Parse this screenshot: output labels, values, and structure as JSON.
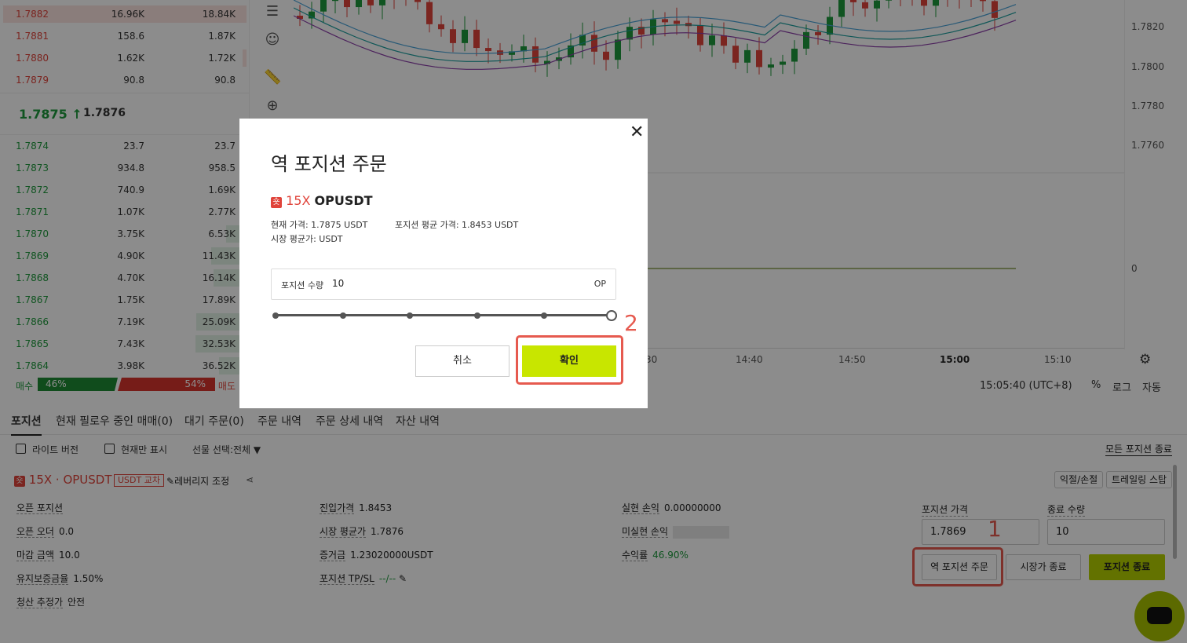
{
  "orderbook": {
    "asks": [
      {
        "price": "1.7882",
        "amount": "16.96K",
        "total": "18.84K",
        "depth": 1.0
      },
      {
        "price": "1.7881",
        "amount": "158.6",
        "total": "1.87K",
        "depth": 0.0
      },
      {
        "price": "1.7880",
        "amount": "1.62K",
        "total": "1.72K",
        "depth": 0.04
      },
      {
        "price": "1.7879",
        "amount": "90.8",
        "total": "90.8",
        "depth": 0.0
      }
    ],
    "last_price": "1.7875",
    "last_arrow": "↑",
    "mark_price": "1.7876",
    "bids": [
      {
        "price": "1.7874",
        "amount": "23.7",
        "total": "23.7",
        "depth": 0.0
      },
      {
        "price": "1.7873",
        "amount": "934.8",
        "total": "958.5",
        "depth": 0.0
      },
      {
        "price": "1.7872",
        "amount": "740.9",
        "total": "1.69K",
        "depth": 0.0
      },
      {
        "price": "1.7871",
        "amount": "1.07K",
        "total": "2.77K",
        "depth": 0.0
      },
      {
        "price": "1.7870",
        "amount": "3.75K",
        "total": "6.53K",
        "depth": 0.19
      },
      {
        "price": "1.7869",
        "amount": "4.90K",
        "total": "11.43K",
        "depth": 0.33
      },
      {
        "price": "1.7868",
        "amount": "4.70K",
        "total": "16.14K",
        "depth": 0.31
      },
      {
        "price": "1.7867",
        "amount": "1.75K",
        "total": "17.89K",
        "depth": 0.0
      },
      {
        "price": "1.7866",
        "amount": "7.19K",
        "total": "25.09K",
        "depth": 0.47
      },
      {
        "price": "1.7865",
        "amount": "7.43K",
        "total": "32.53K",
        "depth": 0.48
      },
      {
        "price": "1.7864",
        "amount": "3.98K",
        "total": "36.52K",
        "depth": 0.26
      }
    ],
    "buy_label": "매수",
    "buy_pct": "46%",
    "sell_pct": "54%",
    "sell_label": "매도"
  },
  "chart": {
    "price_labels": [
      "1.7820",
      "1.7800",
      "1.7780",
      "1.7760",
      "0"
    ],
    "time_labels": [
      "30",
      "14:40",
      "14:50",
      "15:00",
      "15:10"
    ],
    "clock": "15:05:40 (UTC+8)",
    "footer": {
      "pct": "%",
      "log": "로그",
      "auto": "자동"
    }
  },
  "tabs": [
    "포지션",
    "현재 필로우 중인 매매(0)",
    "대기 주문(0)",
    "주문 내역",
    "주문 상세 내역",
    "자산 내역"
  ],
  "filters": {
    "lite": "라이트 버전",
    "current_only": "현재만 표시",
    "futures_select": "선물 선택:전체 ▼",
    "close_all": "모든 포지션 종료"
  },
  "position": {
    "badge": "숏",
    "title": "15X · OPUSDT",
    "margin_mode": "USDT 교차",
    "leverage_adjust": "레버리지 조정",
    "tp_sl_btn": "익절/손절",
    "trailing_btn": "트레일링 스탑",
    "col1": [
      {
        "k": "오픈 포지션",
        "v": ""
      },
      {
        "k": "오픈 오더",
        "v": "0.0"
      },
      {
        "k": "마감 금액",
        "v": "10.0"
      },
      {
        "k": "유지보증금율",
        "v": "1.50%"
      },
      {
        "k": "청산 추정가",
        "v": "안전"
      }
    ],
    "col2": [
      {
        "k": "진입가격",
        "v": "1.8453"
      },
      {
        "k": "시장 평균가",
        "v": "1.7876"
      },
      {
        "k": "증거금",
        "v": "1.23020000USDT"
      },
      {
        "k": "포지션 TP/SL",
        "v": "--/--"
      }
    ],
    "col3": [
      {
        "k": "실현 손익",
        "v": "0.00000000"
      },
      {
        "k": "미실현 손익",
        "v": ""
      },
      {
        "k": "수익률",
        "v": "46.90%"
      }
    ],
    "price_label": "포지션 가격",
    "price_value": "1.7869",
    "qty_label": "종료 수량",
    "qty_value": "10",
    "reverse_btn": "역 포지션 주문",
    "market_close_btn": "시장가 종료",
    "close_btn": "포지션 종료"
  },
  "modal": {
    "title": "역 포지션 주문",
    "badge": "숏",
    "leverage": "15X",
    "symbol": "OPUSDT",
    "current_price": "현재 가격:  1.7875 USDT",
    "avg_position_price": "포지션 평균 가격:  1.8453 USDT",
    "market_avg": "시장 평균가:  USDT",
    "qty_label": "포지션 수량",
    "qty_value": "10",
    "qty_unit": "OP",
    "slider_value": 1.0,
    "cancel": "취소",
    "confirm": "확인"
  },
  "annotations": {
    "one": "1",
    "two": "2",
    "color": "#e65a4f"
  }
}
